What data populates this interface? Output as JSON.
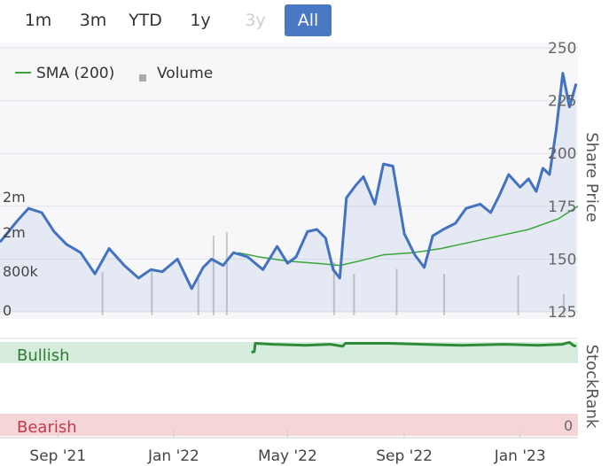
{
  "range_buttons": [
    {
      "label": "1m",
      "state": "normal"
    },
    {
      "label": "3m",
      "state": "normal"
    },
    {
      "label": "YTD",
      "state": "normal"
    },
    {
      "label": "1y",
      "state": "normal"
    },
    {
      "label": "3y",
      "state": "disabled"
    },
    {
      "label": "All",
      "state": "active"
    }
  ],
  "colors": {
    "price": "#4372c0",
    "sma": "#3aa63a",
    "volume": "#c8c8c8",
    "stockrank": "#2e8b3a",
    "bullish_band": "#d6ecdc",
    "bearish_band": "#f5d5d8",
    "bullish_text": "#2e7d32",
    "bearish_text": "#c0394b",
    "active_button": "#4a78c2"
  },
  "chart_data": [
    {
      "type": "line",
      "legend": [
        "SMA (200)",
        "Volume"
      ],
      "legend_position": "top-left",
      "ylabel": "Share Price",
      "y_ticks": [
        125,
        150,
        175,
        200,
        225,
        250
      ],
      "ylim": [
        125,
        250
      ],
      "volume_ticks": [
        "0",
        "800k",
        "2m",
        "2m"
      ],
      "x_ticks": [
        "Sep '21",
        "Jan '22",
        "May '22",
        "Sep '22",
        "Jan '23"
      ],
      "xlim": [
        "2021-07-02",
        "2023-03-03"
      ],
      "series": [
        {
          "name": "Share Price",
          "x": [
            "2021-07-02",
            "2021-07-20",
            "2021-08-01",
            "2021-08-15",
            "2021-08-28",
            "2021-09-10",
            "2021-09-25",
            "2021-10-10",
            "2021-10-25",
            "2021-11-10",
            "2021-11-25",
            "2021-12-08",
            "2021-12-20",
            "2022-01-05",
            "2022-01-20",
            "2022-02-01",
            "2022-02-10",
            "2022-02-22",
            "2022-03-05",
            "2022-03-20",
            "2022-04-05",
            "2022-04-20",
            "2022-05-01",
            "2022-05-10",
            "2022-05-22",
            "2022-06-01",
            "2022-06-10",
            "2022-06-18",
            "2022-06-25",
            "2022-07-02",
            "2022-07-12",
            "2022-07-20",
            "2022-08-01",
            "2022-08-10",
            "2022-08-20",
            "2022-09-01",
            "2022-09-12",
            "2022-09-22",
            "2022-10-01",
            "2022-10-12",
            "2022-10-25",
            "2022-11-05",
            "2022-11-20",
            "2022-12-01",
            "2022-12-10",
            "2022-12-20",
            "2023-01-01",
            "2023-01-10",
            "2023-01-18",
            "2023-01-25",
            "2023-02-01",
            "2023-02-08",
            "2023-02-15",
            "2023-02-22",
            "2023-03-01"
          ],
          "values": [
            158,
            168,
            174,
            172,
            163,
            157,
            153,
            143,
            155,
            147,
            141,
            145,
            144,
            150,
            136,
            146,
            150,
            147,
            153,
            151,
            145,
            156,
            148,
            151,
            163,
            164,
            160,
            145,
            141,
            179,
            185,
            189,
            176,
            195,
            194,
            162,
            152,
            146,
            161,
            164,
            167,
            174,
            176,
            172,
            180,
            190,
            184,
            188,
            182,
            193,
            190,
            211,
            238,
            222,
            233
          ]
        },
        {
          "name": "SMA (200)",
          "x": [
            "2022-03-10",
            "2022-04-01",
            "2022-05-01",
            "2022-06-01",
            "2022-06-25",
            "2022-07-15",
            "2022-08-10",
            "2022-09-10",
            "2022-10-10",
            "2022-11-10",
            "2022-12-10",
            "2023-01-10",
            "2023-02-10",
            "2023-03-03"
          ],
          "values": [
            153,
            151,
            149,
            148,
            147,
            149,
            152,
            153,
            155,
            158,
            161,
            164,
            169,
            175
          ]
        },
        {
          "name": "Volume",
          "x": [
            "2021-10-18",
            "2021-12-09",
            "2022-01-27",
            "2022-02-12",
            "2022-02-26",
            "2022-06-19",
            "2022-07-10",
            "2022-08-24",
            "2022-10-13",
            "2022-12-30",
            "2023-02-16"
          ],
          "values": [
            1300000,
            1400000,
            1100000,
            2400000,
            2500000,
            1600000,
            1250000,
            1400000,
            1250000,
            1200000,
            650000
          ]
        }
      ]
    },
    {
      "type": "line",
      "ylabel": "StockRank",
      "bands": [
        "Bullish",
        "Bearish"
      ],
      "y_tick": "0",
      "series": [
        {
          "name": "StockRank",
          "x": [
            "2022-03-24",
            "2022-03-27",
            "2022-03-28",
            "2022-04-15",
            "2022-05-20",
            "2022-06-15",
            "2022-06-28",
            "2022-07-01",
            "2022-08-15",
            "2022-09-20",
            "2022-11-01",
            "2022-12-15",
            "2023-01-20",
            "2023-02-15",
            "2023-02-18",
            "2023-02-22",
            "2023-02-26",
            "2023-03-01"
          ],
          "values": [
            81,
            82,
            90,
            89,
            88,
            89,
            87,
            90,
            90,
            89,
            88,
            89,
            88,
            89,
            90,
            91,
            88,
            87
          ]
        }
      ]
    }
  ]
}
